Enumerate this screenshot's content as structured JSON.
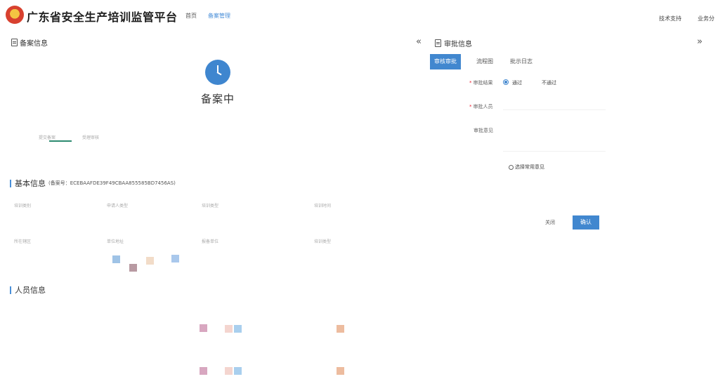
{
  "header": {
    "app_title": "广东省安全生产培训监管平台",
    "nav": [
      {
        "label": "首页"
      },
      {
        "label": "备案管理"
      }
    ],
    "links": [
      "技术支持",
      "业务分"
    ]
  },
  "left": {
    "section_title": "备案信息",
    "status_text": "备案中",
    "steps": [
      "提交备案",
      "受理审核",
      "",
      "",
      "",
      "",
      "",
      "",
      "",
      ""
    ],
    "step_sub": "",
    "basic": {
      "title": "基本信息",
      "record_no_label": "(备案号：",
      "record_no": "ECEBAAFDE39F49CBAA855585BD7456AS",
      "record_no_close": ")",
      "row1_labels": [
        "培训类别",
        "申请人类型",
        "培训类型",
        "培训时间"
      ],
      "row2_labels": [
        "所在辖区",
        "单位地址",
        "报备单位",
        "培训类型"
      ]
    },
    "people": {
      "title": "人员信息",
      "row1_labels": [
        "",
        "",
        "",
        ""
      ],
      "row2_labels": [
        "",
        "",
        "",
        ""
      ]
    }
  },
  "right": {
    "collapse_left": "«",
    "collapse_right": "»",
    "panel_title": "审批信息",
    "tabs": [
      "审核审批",
      "流程图",
      "批示日志"
    ],
    "form": {
      "result_label": "审批结果",
      "radio_pass": "通过",
      "radio_reject": "不通过",
      "person_label": "审批人员",
      "person_placeholder": "",
      "opinion_label": "审批意见",
      "opinion_placeholder": "",
      "common_opinion": "选择常用意见"
    },
    "cancel": "关闭",
    "confirm": "确认"
  }
}
